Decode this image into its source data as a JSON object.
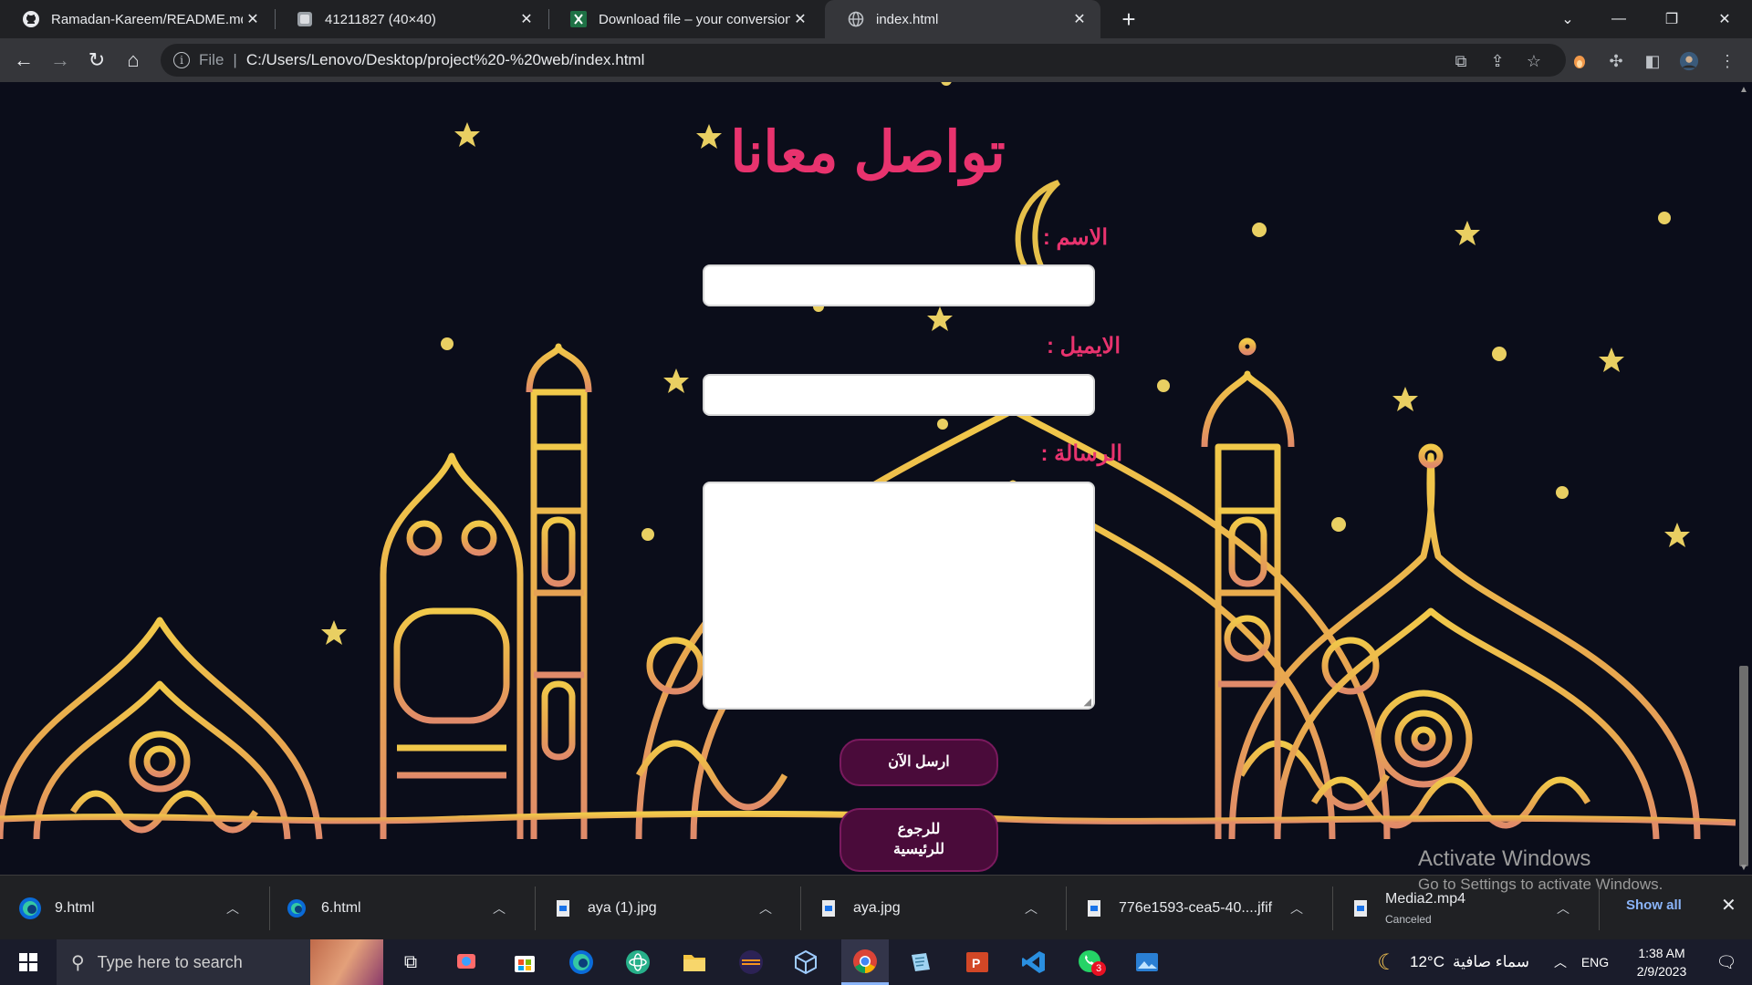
{
  "browser": {
    "tabs": [
      {
        "title": "Ramadan-Kareem/README.md at",
        "icon": "github-icon"
      },
      {
        "title": "41211827 (40×40)",
        "icon": "image-icon"
      },
      {
        "title": "Download file – your conversion",
        "icon": "excel-icon"
      },
      {
        "title": "index.html",
        "icon": "globe-icon",
        "active": true
      }
    ],
    "address": {
      "scheme": "File",
      "url": "C:/Users/Lenovo/Desktop/project%20-%20web/index.html"
    }
  },
  "page": {
    "heading": "تواصل معانا",
    "name_label": "الاسم :",
    "email_label": "الايميل :",
    "message_label": "الرسالة :",
    "send_button": "ارسل الآن",
    "back_button": "للرجوع للرئيسية",
    "colors": {
      "accent": "#e8336e",
      "background": "#0b0d1a",
      "button": "#4a0b3a",
      "ornament": "#e6b04a"
    }
  },
  "watermark": {
    "title": "Activate Windows",
    "subtitle": "Go to Settings to activate Windows."
  },
  "downloads": {
    "items": [
      {
        "name": "9.html",
        "icon": "edge-icon"
      },
      {
        "name": "6.html",
        "icon": "edge-icon"
      },
      {
        "name": "aya (1).jpg",
        "icon": "file-icon"
      },
      {
        "name": "aya.jpg",
        "icon": "file-icon"
      },
      {
        "name": "776e1593-cea5-40....jfif",
        "icon": "file-icon"
      },
      {
        "name": "Media2.mp4",
        "status": "Canceled",
        "icon": "file-icon"
      }
    ],
    "show_all": "Show all"
  },
  "taskbar": {
    "search_placeholder": "Type here to search",
    "weather_temp": "12°C",
    "weather_text": "سماء صافية",
    "language": "ENG",
    "time": "1:38 AM",
    "date": "2/9/2023",
    "notification_badge": "3"
  }
}
